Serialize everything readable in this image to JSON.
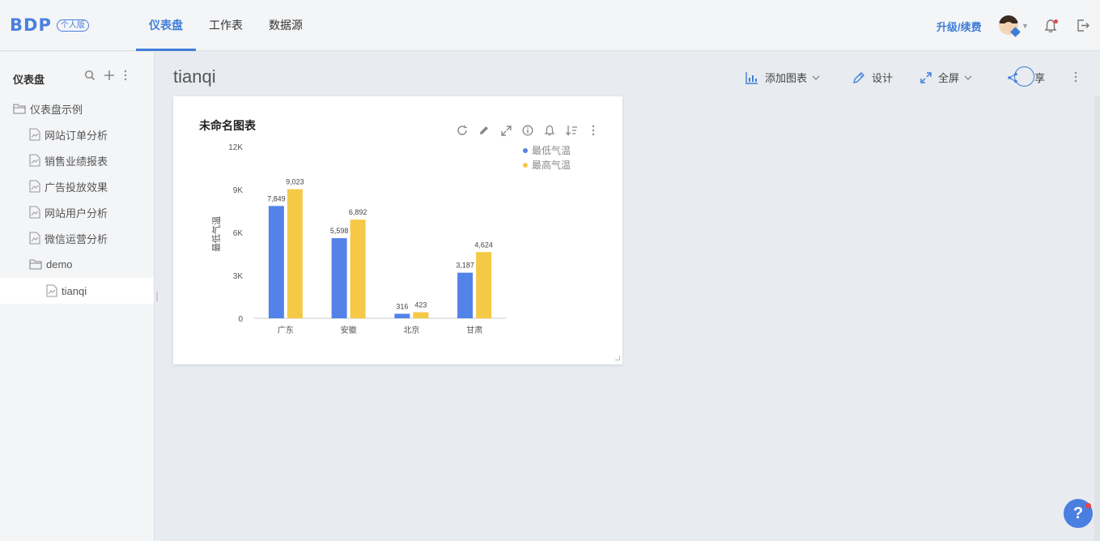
{
  "header": {
    "logo": "BDP",
    "logo_badge": "个人版",
    "tabs": [
      {
        "label": "仪表盘",
        "active": true
      },
      {
        "label": "工作表",
        "active": false
      },
      {
        "label": "数据源",
        "active": false
      }
    ],
    "upgrade_label": "升级/续费",
    "accent_color": "#3f7ed8"
  },
  "sidebar": {
    "title": "仪表盘",
    "items": [
      {
        "label": "仪表盘示例",
        "type": "folder"
      },
      {
        "label": "网站订单分析",
        "type": "dashboard"
      },
      {
        "label": "销售业绩报表",
        "type": "dashboard"
      },
      {
        "label": "广告投放效果",
        "type": "dashboard"
      },
      {
        "label": "网站用户分析",
        "type": "dashboard"
      },
      {
        "label": "微信运营分析",
        "type": "dashboard"
      },
      {
        "label": "demo",
        "type": "folder"
      },
      {
        "label": "tianqi",
        "type": "dashboard",
        "selected": true
      }
    ]
  },
  "main": {
    "title": "tianqi",
    "toolbar": {
      "add_chart": "添加图表",
      "design": "设计",
      "fullscreen": "全屏",
      "share": "享"
    }
  },
  "card": {
    "title": "未命名图表"
  },
  "chart_data": {
    "type": "bar",
    "title": "未命名图表",
    "ylabel": "最低气温",
    "xlabel": "",
    "categories": [
      "广东",
      "安徽",
      "北京",
      "甘肃"
    ],
    "series": [
      {
        "name": "最低气温",
        "color": "#5383e8",
        "values": [
          7849,
          5598,
          316,
          3187
        ],
        "labels": [
          "7,849",
          "5,598",
          "316",
          "3,187"
        ]
      },
      {
        "name": "最高气温",
        "color": "#f5c945",
        "values": [
          9023,
          6892,
          423,
          4624
        ],
        "labels": [
          "9,023",
          "6,892",
          "423",
          "4,624"
        ]
      }
    ],
    "yticks": [
      0,
      3000,
      6000,
      9000,
      12000
    ],
    "ytick_labels": [
      "0",
      "3K",
      "6K",
      "9K",
      "12K"
    ],
    "ylim": [
      0,
      12000
    ],
    "grid": false,
    "legend": "top-right"
  }
}
